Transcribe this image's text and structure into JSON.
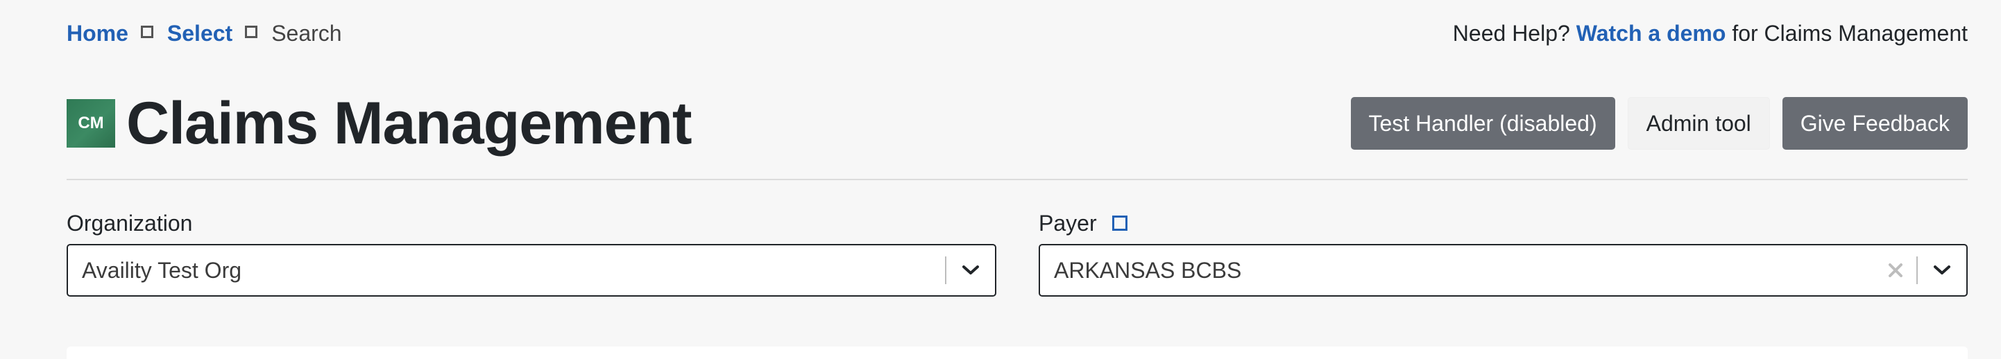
{
  "breadcrumb": {
    "home": "Home",
    "select": "Select",
    "current": "Search"
  },
  "help": {
    "prefix": "Need Help?",
    "link": "Watch a demo",
    "suffix": "for Claims Management"
  },
  "header": {
    "logo_text": "CM",
    "title": "Claims Management",
    "buttons": {
      "test_handler": "Test Handler (disabled)",
      "admin_tool": "Admin tool",
      "feedback": "Give Feedback"
    }
  },
  "filters": {
    "organization": {
      "label": "Organization",
      "value": "Availity Test Org"
    },
    "payer": {
      "label": "Payer",
      "value": "ARKANSAS BCBS"
    }
  },
  "icons": {
    "breadcrumb_separator": "square-separator-icon",
    "info": "info-icon",
    "chevron": "chevron-down-icon",
    "clear": "clear-icon"
  },
  "colors": {
    "link": "#2261b5",
    "logo": "#2f7a55",
    "dark_button": "#686c73",
    "background": "#f7f7f7"
  }
}
